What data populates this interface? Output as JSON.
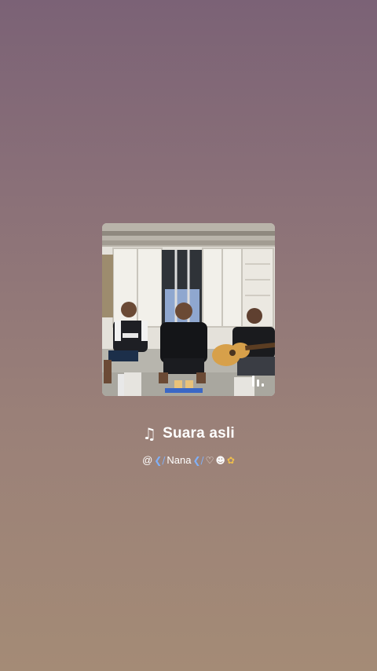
{
  "track": {
    "title": "Suara asli",
    "author_prefix": "@",
    "author_name": "Nana",
    "note_icon": "music-note-icon",
    "author_decorations": [
      "❮/",
      "❮/",
      "♡",
      "☻",
      "✿"
    ]
  },
  "cover": {
    "description_icon": "album-cover",
    "playing_indicator": "now-playing-bars-icon"
  },
  "colors": {
    "background_top": "#7b6276",
    "background_bottom": "#a48b76",
    "text": "#ffffff"
  }
}
